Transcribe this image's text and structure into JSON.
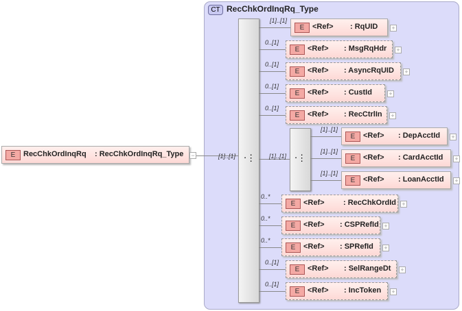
{
  "complex_type": {
    "badge": "CT",
    "title": "RecChkOrdInqRq_Type"
  },
  "root": {
    "badge": "E",
    "name": "RecChkOrdInqRq",
    "type": ": RecChkOrdInqRq_Type",
    "multiplicity": "[1]..[1]"
  },
  "inner_choice_multiplicity": "[1]..[1]",
  "children": [
    {
      "badge": "E",
      "ref": "<Ref>",
      "name": ": RqUID",
      "multiplicity": "[1]..[1]",
      "optional": false
    },
    {
      "badge": "E",
      "ref": "<Ref>",
      "name": ": MsgRqHdr",
      "multiplicity": "0..[1]",
      "optional": true
    },
    {
      "badge": "E",
      "ref": "<Ref>",
      "name": ": AsyncRqUID",
      "multiplicity": "0..[1]",
      "optional": true
    },
    {
      "badge": "E",
      "ref": "<Ref>",
      "name": ": CustId",
      "multiplicity": "0..[1]",
      "optional": true
    },
    {
      "badge": "E",
      "ref": "<Ref>",
      "name": ": RecCtrlIn",
      "multiplicity": "0..[1]",
      "optional": true
    },
    {
      "badge": "E",
      "ref": "<Ref>",
      "name": ": DepAcctId",
      "multiplicity": "[1]..[1]",
      "optional": false
    },
    {
      "badge": "E",
      "ref": "<Ref>",
      "name": ": CardAcctId",
      "multiplicity": "[1]..[1]",
      "optional": false
    },
    {
      "badge": "E",
      "ref": "<Ref>",
      "name": ": LoanAcctId",
      "multiplicity": "[1]..[1]",
      "optional": false
    },
    {
      "badge": "E",
      "ref": "<Ref>",
      "name": ": RecChkOrdId",
      "multiplicity": "0..*",
      "optional": true
    },
    {
      "badge": "E",
      "ref": "<Ref>",
      "name": ": CSPRefId",
      "multiplicity": "0..*",
      "optional": true
    },
    {
      "badge": "E",
      "ref": "<Ref>",
      "name": ": SPRefId",
      "multiplicity": "0..*",
      "optional": true
    },
    {
      "badge": "E",
      "ref": "<Ref>",
      "name": ": SelRangeDt",
      "multiplicity": "0..[1]",
      "optional": true
    },
    {
      "badge": "E",
      "ref": "<Ref>",
      "name": ": IncToken",
      "multiplicity": "0..[1]",
      "optional": true
    }
  ]
}
